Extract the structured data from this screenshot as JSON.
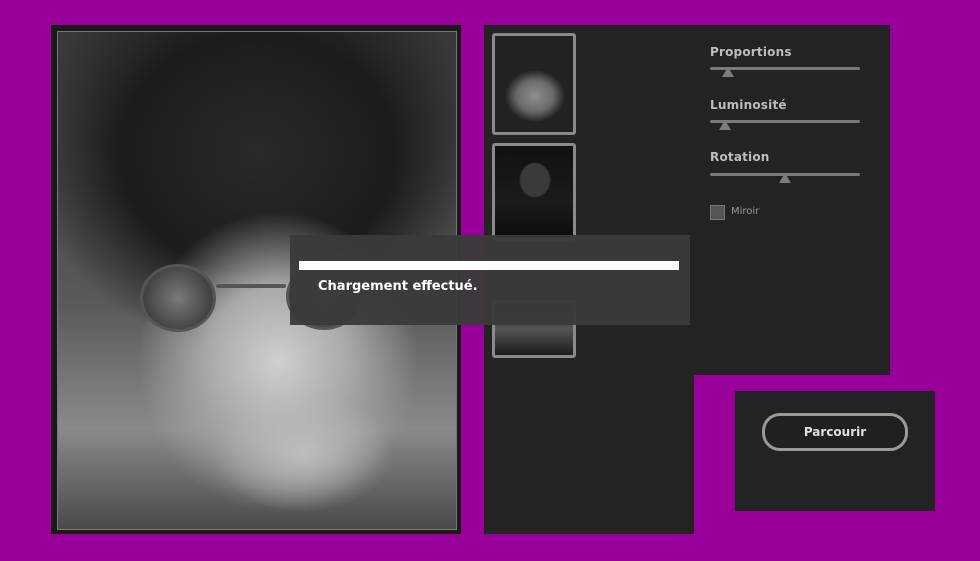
{
  "editor": {
    "photo_alt": "Photo montage",
    "thumbnails": [
      {
        "name": "face-with-glasses"
      },
      {
        "name": "suit-and-tie"
      },
      {
        "name": "group-photo"
      }
    ]
  },
  "controls": {
    "proportions": {
      "label": "Proportions",
      "value": 0.12
    },
    "luminosity": {
      "label": "Luminosité",
      "value": 0.1
    },
    "rotation": {
      "label": "Rotation",
      "value": 0.5
    },
    "mirror": {
      "label": "Miroir",
      "checked": false
    }
  },
  "browse": {
    "label": "Parcourir"
  },
  "dialog": {
    "message": "Chargement effectué.",
    "progress": 1.0
  },
  "colors": {
    "background": "#990099",
    "panel": "#232323"
  }
}
